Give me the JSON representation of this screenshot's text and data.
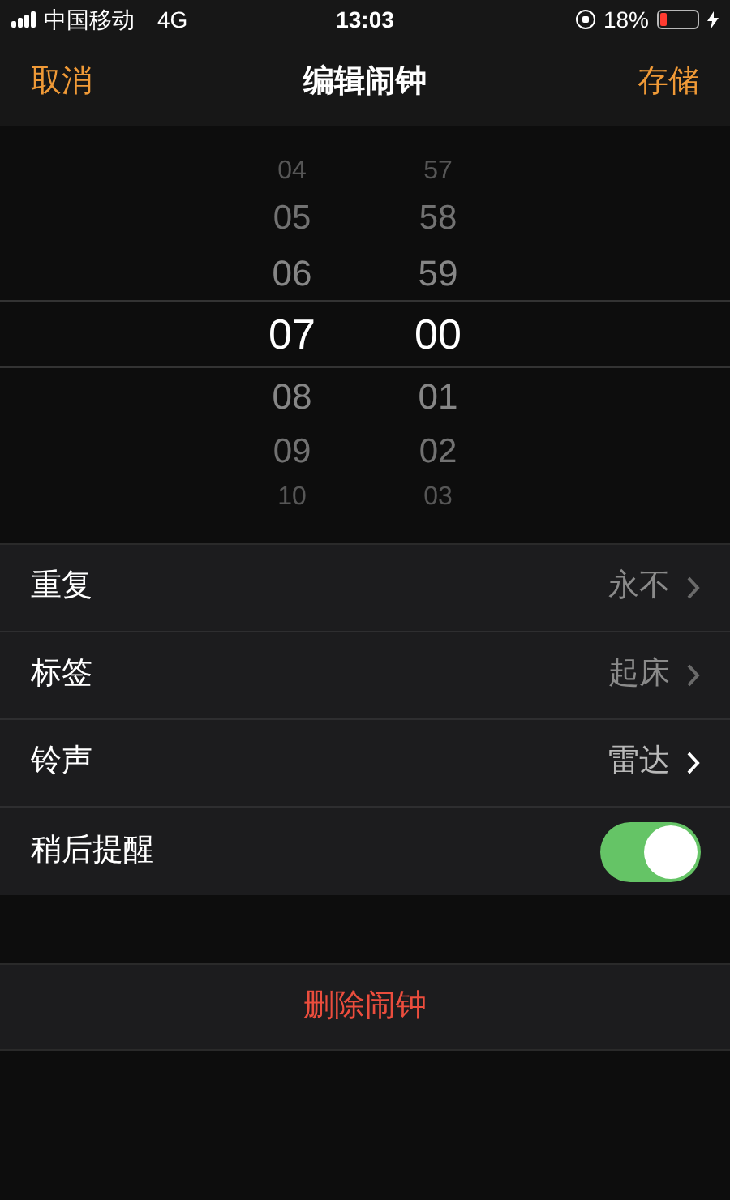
{
  "status_bar": {
    "carrier": "中国移动",
    "network": "4G",
    "time": "13:03",
    "battery_percent": "18%",
    "battery": {
      "level": 0.18
    }
  },
  "nav": {
    "cancel": "取消",
    "title": "编辑闹钟",
    "save": "存储"
  },
  "picker": {
    "columns": [
      {
        "items": [
          {
            "label": "04",
            "selected": false
          },
          {
            "label": "05",
            "selected": false
          },
          {
            "label": "06",
            "selected": false
          },
          {
            "label": "07",
            "selected": true
          },
          {
            "label": "08",
            "selected": false
          },
          {
            "label": "09",
            "selected": false
          },
          {
            "label": "10",
            "selected": false
          }
        ]
      },
      {
        "items": [
          {
            "label": "57",
            "selected": false
          },
          {
            "label": "58",
            "selected": false
          },
          {
            "label": "59",
            "selected": false
          },
          {
            "label": "00",
            "selected": true
          },
          {
            "label": "01",
            "selected": false
          },
          {
            "label": "02",
            "selected": false
          },
          {
            "label": "03",
            "selected": false
          }
        ]
      }
    ]
  },
  "settings": [
    {
      "kind": "value",
      "label": "重复",
      "value": "永不",
      "active": false
    },
    {
      "kind": "value",
      "label": "标签",
      "value": "起床",
      "active": false
    },
    {
      "kind": "value",
      "label": "铃声",
      "value": "雷达",
      "active": true
    },
    {
      "kind": "toggle",
      "label": "稍后提醒",
      "on": true
    }
  ],
  "delete_button": "删除闹钟"
}
